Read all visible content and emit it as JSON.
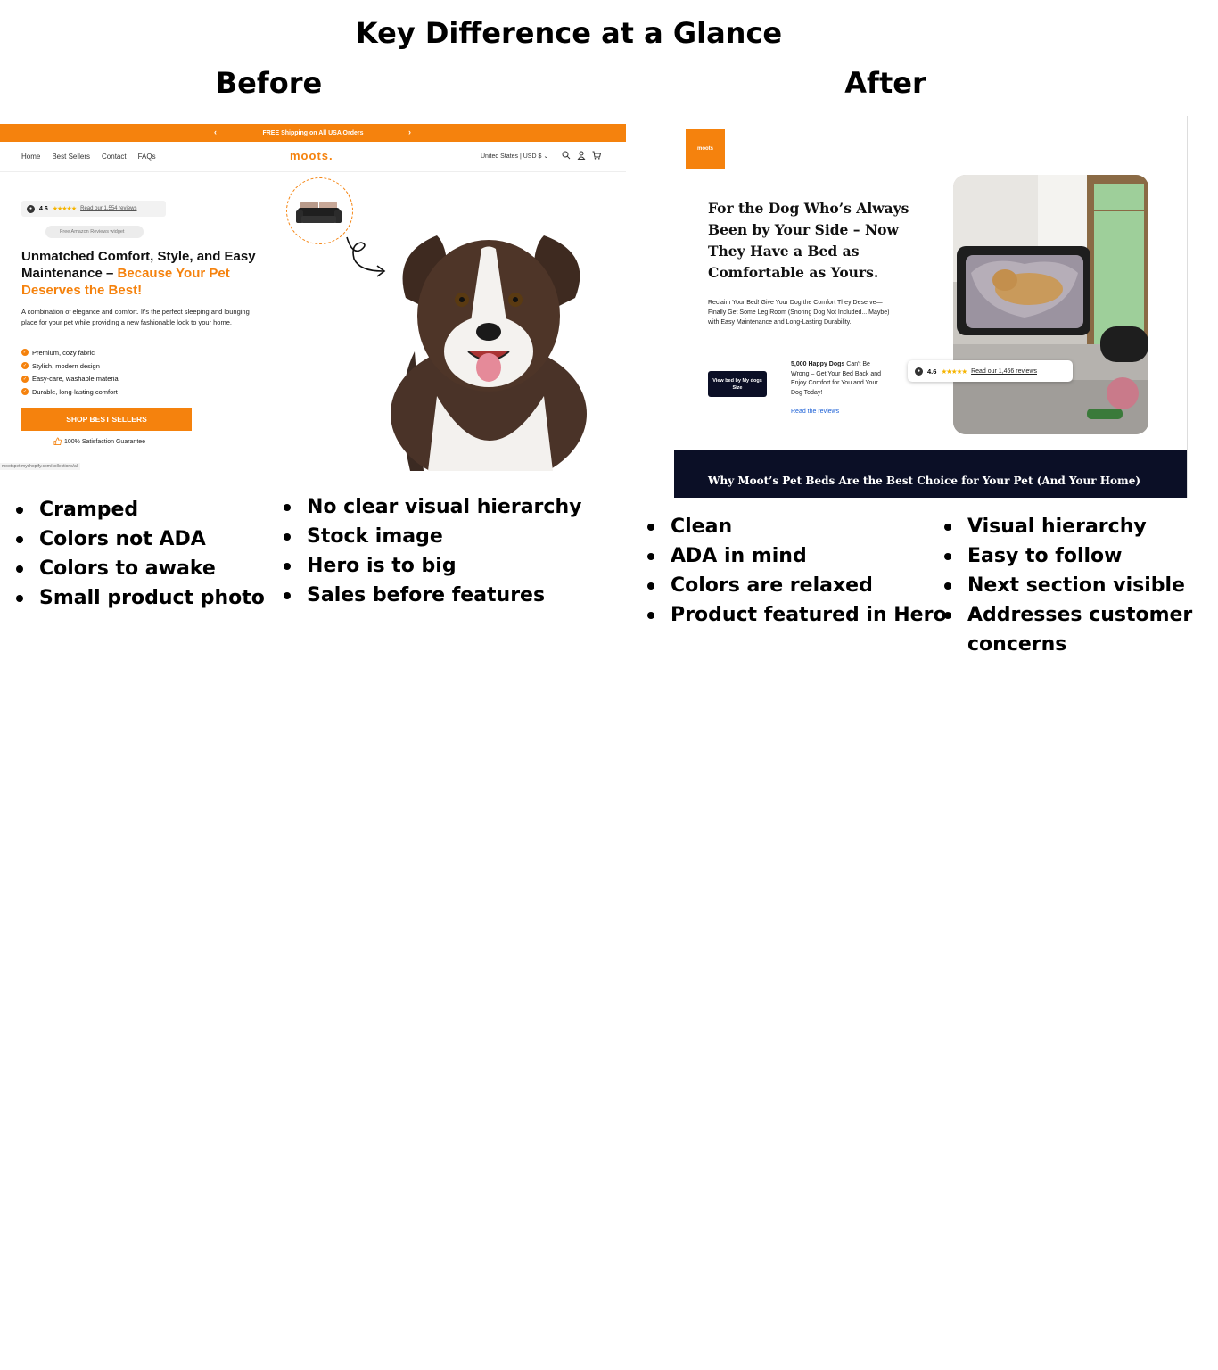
{
  "title": "Key Difference at a Glance",
  "before": {
    "label": "Before",
    "screenshot": {
      "banner_text": "FREE Shipping on All USA Orders",
      "nav_links": [
        "Home",
        "Best Sellers",
        "Contact",
        "FAQs"
      ],
      "logo": "moots.",
      "locale": "United States | USD $",
      "rating_value": "4.6",
      "rating_link": "Read our 1,554 reviews",
      "widget_text": "Free Amazon Reviews widget",
      "headline_plain": "Unmatched Comfort, Style, and Easy Maintenance – ",
      "headline_accent": "Because Your Pet Deserves the Best!",
      "description": "A combination of elegance and comfort. It's the perfect sleeping and lounging place for your pet while providing a new fashionable look to your home.",
      "features": [
        "Premium, cozy fabric",
        "Stylish, modern design",
        "Easy-care, washable material",
        "Durable, long-lasting comfort"
      ],
      "cta": "SHOP BEST SELLERS",
      "guarantee": "100% Satisfaction Guarantee",
      "url": "mootspet.myshopify.com/collections/all"
    },
    "notes_col1": [
      "Cramped",
      "Colors not ADA",
      "Colors to awake",
      "Small product photo"
    ],
    "notes_col2": [
      "No clear visual hierarchy",
      "Stock image",
      "Hero is to big",
      "Sales before features"
    ]
  },
  "after": {
    "label": "After",
    "screenshot": {
      "logo": "moots",
      "headline_1": "For the Dog Who’s Always Been by ",
      "headline_2": "Your Side",
      "headline_3": " – Now They Have a Bed as Comfortable as ",
      "headline_4": "Yours.",
      "subtext": "Reclaim Your Bed! Give Your Dog the Comfort They Deserve—Finally Get Some Leg Room (Snoring Dog Not Included... Maybe) with Easy Maintenance and Long-Lasting Durability.",
      "cta": "View bed by My dogs Size",
      "happy_bold": "5,000 Happy Dogs",
      "happy_rest": " Can't Be Wrong – Get Your Bed Back and Enjoy Comfort for You and Your Dog Today!",
      "reviews_link": "Read the reviews",
      "rating_value": "4.6",
      "rating_link": "Read our 1,466 reviews",
      "next_section": "Why Moot’s Pet Beds Are the Best Choice for Your Pet (And Your Home)"
    },
    "notes_col1": [
      "Clean",
      "ADA in mind",
      "Colors are relaxed",
      "Product featured in Hero"
    ],
    "notes_col2": [
      "Visual hierarchy",
      "Easy to follow",
      "Next section visible",
      "Addresses customer concerns"
    ]
  },
  "colors": {
    "accent_orange": "#f5820d",
    "navy": "#0b0f26",
    "star": "#f5b400",
    "link_blue": "#1a5fd6"
  },
  "icons": [
    "search-icon",
    "user-icon",
    "cart-icon",
    "check-icon",
    "thumbs-up-icon",
    "star-icon",
    "chevron-left-icon",
    "chevron-right-icon",
    "chevron-down-icon"
  ]
}
